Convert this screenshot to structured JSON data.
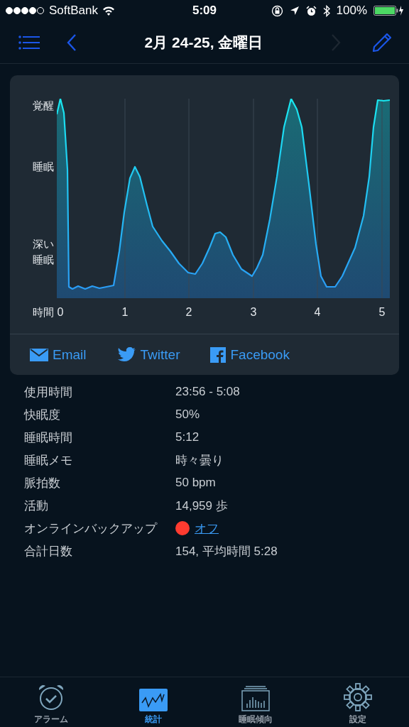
{
  "status_bar": {
    "carrier": "SoftBank",
    "time": "5:09",
    "battery": "100%"
  },
  "nav": {
    "title": "2月 24-25, 金曜日",
    "next_disabled": true
  },
  "chart": {
    "y_labels": [
      "覚醒",
      "睡眠",
      "深い睡眠"
    ],
    "x_label": "時間",
    "x_ticks": [
      "0",
      "1",
      "2",
      "3",
      "4",
      "5"
    ]
  },
  "share": [
    {
      "kind": "email",
      "label": "Email"
    },
    {
      "kind": "twitter",
      "label": "Twitter"
    },
    {
      "kind": "facebook",
      "label": "Facebook"
    }
  ],
  "details": [
    {
      "label": "使用時間",
      "value": "23:56 - 5:08"
    },
    {
      "label": "快眠度",
      "value": "50%"
    },
    {
      "label": "睡眠時間",
      "value": "5:12"
    },
    {
      "label": "睡眠メモ",
      "value": "時々曇り"
    },
    {
      "label": "脈拍数",
      "value": "50 bpm"
    },
    {
      "label": "活動",
      "value": "14,959 歩"
    },
    {
      "label": "オンラインバックアップ",
      "value": "オフ",
      "kind": "toggle-link",
      "on": false
    },
    {
      "label": "合計日数",
      "value": "154, 平均時間 5:28"
    }
  ],
  "tabs": [
    {
      "kind": "alarm",
      "label": "アラーム",
      "selected": false
    },
    {
      "kind": "stats",
      "label": "統計",
      "selected": true
    },
    {
      "kind": "trend",
      "label": "睡眠傾向",
      "selected": false
    },
    {
      "kind": "settings",
      "label": "設定",
      "selected": false
    }
  ]
}
